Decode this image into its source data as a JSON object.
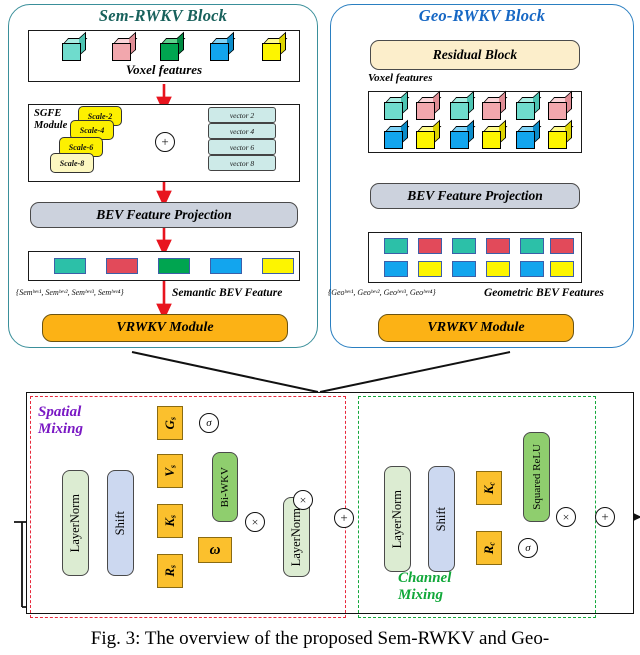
{
  "figure": {
    "caption": "Fig. 3: The overview of the proposed Sem-RWKV and Geo-"
  },
  "sem_block": {
    "title": "Sem-RWKV Block",
    "voxel_label": "Voxel features",
    "voxel_cubes": [
      {
        "name": "cube-teal",
        "color": "#6fdccd"
      },
      {
        "name": "cube-pink",
        "color": "#f2a7ad"
      },
      {
        "name": "cube-green",
        "color": "#00a550"
      },
      {
        "name": "cube-blue",
        "color": "#12a5ee"
      },
      {
        "name": "cube-yellow",
        "color": "#fdf500"
      }
    ],
    "sgfe": {
      "label_line1": "SGFE",
      "label_line2": "Module",
      "scales": [
        "Scale-2",
        "Scale-4",
        "Scale-6",
        "Scale-8"
      ],
      "vectors": [
        "vector 2",
        "vector 4",
        "vector 6",
        "vector 8"
      ],
      "sum_symbol": "+"
    },
    "bev_projection": "BEV Feature Projection",
    "bev_squares": [
      {
        "name": "square-teal",
        "color": "#2cc0a8"
      },
      {
        "name": "square-red",
        "color": "#e24a5a"
      },
      {
        "name": "square-green",
        "color": "#00a550"
      },
      {
        "name": "square-blue",
        "color": "#12a5ee"
      },
      {
        "name": "square-yellow",
        "color": "#fdf500"
      }
    ],
    "feature_formula": "{Sem₟ᵇᵉᵛ¹, Sem₟ᵇᵉᵛ², Sem₟ᵇᵉᵛ³, Sem₟ᵇᵉᵛ⁴}",
    "feature_caption": "Semantic BEV Feature",
    "vrwkv": "VRWKV Module"
  },
  "geo_block": {
    "title": "Geo-RWKV Block",
    "residual_block": "Residual Block",
    "voxel_label": "Voxel features",
    "voxel_cubes_row1": [
      {
        "color": "#6fdccd"
      },
      {
        "color": "#f2a7ad"
      },
      {
        "color": "#6fdccd"
      },
      {
        "color": "#f2a7ad"
      },
      {
        "color": "#6fdccd"
      },
      {
        "color": "#f2a7ad"
      }
    ],
    "voxel_cubes_row2": [
      {
        "color": "#12a5ee"
      },
      {
        "color": "#fdf500"
      },
      {
        "color": "#12a5ee"
      },
      {
        "color": "#fdf500"
      },
      {
        "color": "#12a5ee"
      },
      {
        "color": "#fdf500"
      }
    ],
    "bev_projection": "BEV Feature Projection",
    "bev_squares_row1": [
      {
        "color": "#2cc0a8"
      },
      {
        "color": "#e24a5a"
      },
      {
        "color": "#2cc0a8"
      },
      {
        "color": "#e24a5a"
      },
      {
        "color": "#2cc0a8"
      },
      {
        "color": "#e24a5a"
      }
    ],
    "bev_squares_row2": [
      {
        "color": "#12a5ee"
      },
      {
        "color": "#fdf500"
      },
      {
        "color": "#12a5ee"
      },
      {
        "color": "#fdf500"
      },
      {
        "color": "#12a5ee"
      },
      {
        "color": "#fdf500"
      }
    ],
    "feature_formula": "{Geo₟ᵇᵉᵛ¹, Geo₟ᵇᵉᵛ², Geo₟ᵇᵉᵛ³, Geo₟ᵇᵉᵛ⁴}",
    "feature_caption": "Geometric BEV Features",
    "vrwkv": "VRWKV Module"
  },
  "spatial_mixing": {
    "label_line1": "Spatial",
    "label_line2": "Mixing",
    "layernorm_1": "LayerNorm",
    "shift": "Shift",
    "gate": "G",
    "gate_sub": "s",
    "value": "V",
    "value_sub": "s",
    "key": "K",
    "key_sub": "s",
    "receptance": "R",
    "receptance_sub": "s",
    "biwkv": "Bi-WKV",
    "omega": "ω",
    "layernorm_2": "LayerNorm",
    "sigma": "σ",
    "mul": "×",
    "add": "+"
  },
  "channel_mixing": {
    "label_line1": "Channel",
    "label_line2": "Mixing",
    "layernorm": "LayerNorm",
    "shift": "Shift",
    "key": "K",
    "key_sub": "c",
    "receptance": "R",
    "receptance_sub": "c",
    "squared_relu": "Squared ReLU",
    "sigma": "σ",
    "mul": "×",
    "add": "+"
  },
  "colors": {
    "sem_title": "#18615c",
    "geo_title": "#1667c4",
    "spatial_dash": "#e8283c",
    "channel_dash": "#14a83c",
    "vrwkv_fill": "#fcb215",
    "bev_fill": "#ccd2dd",
    "residual_fill": "#fceecb",
    "scale_fill": "#fdf000",
    "vector_fill": "#cdeae8"
  }
}
